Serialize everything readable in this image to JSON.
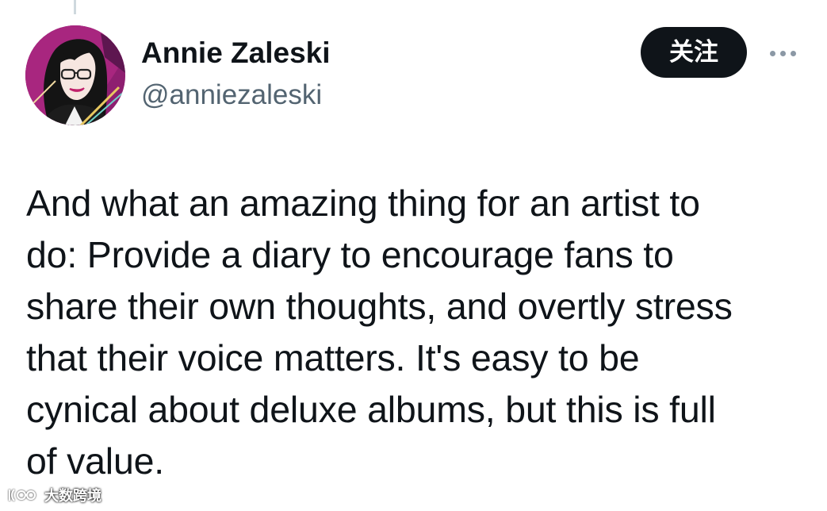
{
  "author": {
    "display_name": "Annie Zaleski",
    "handle": "@anniezaleski",
    "avatar_icon": "illustrated-portrait-avatar"
  },
  "actions": {
    "follow_label": "关注",
    "more_icon": "more-horizontal-icon"
  },
  "tweet": {
    "lines": [
      "And what an amazing thing for an artist to",
      "do: Provide a diary to encourage fans to",
      "share their own thoughts, and overtly stress",
      "that their voice matters. It's easy to be",
      "cynical about deluxe albums, but this is full",
      "of value."
    ]
  },
  "watermark": {
    "text": "大数跨境",
    "logo_icon": "watermark-logo-icon"
  },
  "colors": {
    "text_primary": "#0f1419",
    "text_secondary": "#536471",
    "button_bg": "#0f1419",
    "button_text": "#ffffff",
    "thread_line": "#cfd9de"
  }
}
